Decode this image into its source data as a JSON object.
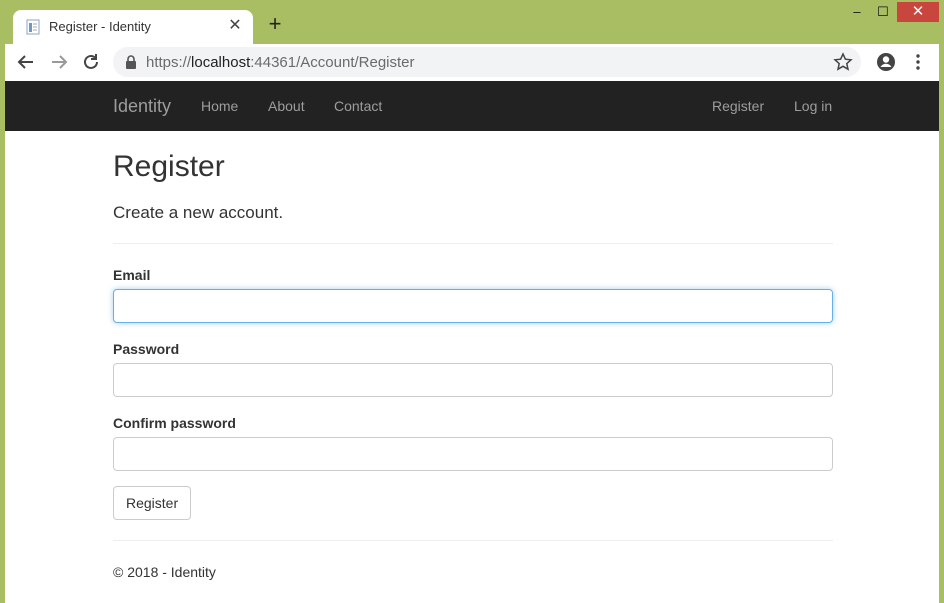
{
  "browser": {
    "tab": {
      "title": "Register - Identity",
      "close_glyph": "✕",
      "favicon": "page-icon"
    },
    "new_tab_glyph": "+",
    "window_controls": {
      "minimize": "–",
      "maximize": "☐",
      "close": "✕"
    },
    "url": {
      "scheme": "https://",
      "host": "localhost",
      "rest": ":44361/Account/Register"
    },
    "icons": [
      "back-arrow-icon",
      "forward-arrow-icon",
      "reload-icon",
      "lock-icon",
      "star-icon",
      "profile-icon",
      "more-menu-icon"
    ]
  },
  "navbar": {
    "brand": "Identity",
    "links": [
      "Home",
      "About",
      "Contact"
    ],
    "right_links": [
      "Register",
      "Log in"
    ]
  },
  "page": {
    "title": "Register",
    "subtitle": "Create a new account.",
    "email_label": "Email",
    "email_value": "",
    "password_label": "Password",
    "password_value": "",
    "confirm_label": "Confirm password",
    "confirm_value": "",
    "submit_label": "Register"
  },
  "footer": {
    "text": "© 2018 - Identity"
  },
  "colors": {
    "frame": "#a9bd63",
    "navbar": "#222222",
    "focus": "#66afe9"
  }
}
